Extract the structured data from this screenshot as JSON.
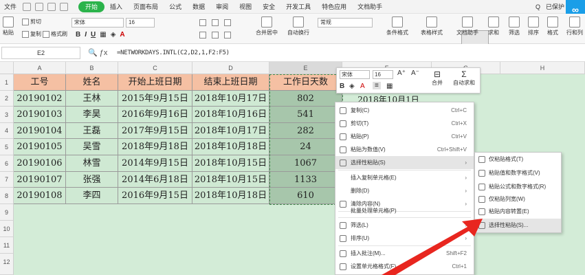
{
  "menubar": {
    "file": "文件",
    "tabs": [
      "开始",
      "插入",
      "页面布局",
      "公式",
      "数据",
      "审阅",
      "视图",
      "安全",
      "开发工具",
      "特色应用",
      "文档助手"
    ],
    "active_tab": "开始",
    "search_placeholder": "Q",
    "share": "已保护",
    "qq_logo": "∞"
  },
  "ribbon": {
    "paste": "粘贴",
    "cut": "剪切",
    "copy": "复制",
    "format_painter": "格式刷",
    "font_name": "宋体",
    "font_size": "16",
    "merge_center": "合并居中",
    "auto_wrap": "自动换行",
    "number_format": "常规",
    "conditional_format": "条件格式",
    "table_style": "表格样式",
    "doc_helper": "文档助手",
    "sum": "求和",
    "filter": "筛选",
    "sort": "排序",
    "fill": "格式",
    "rowcol": "行和列"
  },
  "formula_bar": {
    "name_box": "E2",
    "formula": "=NETWORKDAYS.INTL(C2,D2,1,F2:F5)"
  },
  "columns": [
    "A",
    "B",
    "C",
    "D",
    "E",
    "F",
    "G",
    "H"
  ],
  "rows": [
    "1",
    "2",
    "3",
    "4",
    "5",
    "6",
    "7",
    "8",
    "9",
    "10",
    "11",
    "12"
  ],
  "table": {
    "headers": [
      "工号",
      "姓名",
      "开始上班日期",
      "结束上班日期",
      "工作日天数"
    ],
    "data": [
      [
        "20190102",
        "王林",
        "2015年9月15日",
        "2018年10月17日",
        "802"
      ],
      [
        "20190103",
        "李昊",
        "2016年9月16日",
        "2018年10月16日",
        "541"
      ],
      [
        "20190104",
        "王磊",
        "2017年9月15日",
        "2018年10月17日",
        "282"
      ],
      [
        "20190105",
        "吴雪",
        "2018年9月18日",
        "2018年10月18日",
        "24"
      ],
      [
        "20190106",
        "林雪",
        "2014年9月15日",
        "2018年10月15日",
        "1067"
      ],
      [
        "20190107",
        "张强",
        "2014年6月18日",
        "2018年10月15日",
        "1133"
      ],
      [
        "20190108",
        "李四",
        "2016年9月15日",
        "2018年10月18日",
        "610"
      ]
    ],
    "f2_preview": "2018年10月1日"
  },
  "mini_toolbar": {
    "font": "宋体",
    "size": "16",
    "merge": "合并",
    "autosum": "自动求和"
  },
  "context_menu": [
    {
      "label": "复制(C)",
      "key": "Ctrl+C"
    },
    {
      "label": "剪切(T)",
      "key": "Ctrl+X"
    },
    {
      "label": "粘贴(P)",
      "key": "Ctrl+V"
    },
    {
      "label": "粘贴为数值(V)",
      "key": "Ctrl+Shift+V"
    },
    {
      "label": "选择性粘贴(S)",
      "key": ""
    },
    {
      "label": "插入复制单元格(E)",
      "key": ""
    },
    {
      "label": "删除(D)",
      "key": ""
    },
    {
      "label": "清除内容(N)",
      "key": ""
    },
    {
      "label": "批量处理单元格(P)",
      "key": ""
    },
    {
      "label": "筛选(L)",
      "key": ""
    },
    {
      "label": "排序(U)",
      "key": ""
    },
    {
      "label": "插入批注(M)...",
      "key": "Shift+F2"
    },
    {
      "label": "设置单元格格式(F)...",
      "key": "Ctrl+1"
    }
  ],
  "submenu": [
    "仅粘贴格式(T)",
    "粘贴值和数字格式(V)",
    "粘贴公式和数字格式(R)",
    "仅粘贴列宽(W)",
    "粘贴内容转置(E)",
    "选择性粘贴(S)..."
  ],
  "colors": {
    "accent": "#2bb34b",
    "header_fill": "#f5c0a3",
    "body_fill": "#cfe9d3",
    "arrow": "#e8261f"
  }
}
